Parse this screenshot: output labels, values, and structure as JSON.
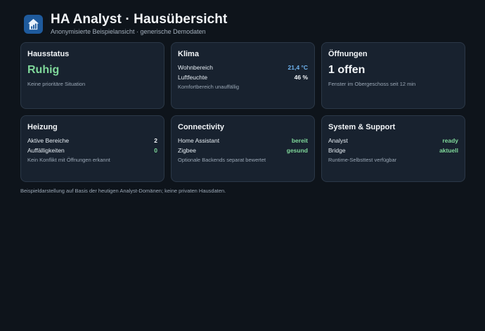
{
  "header": {
    "title": "HA Analyst · Hausübersicht",
    "subtitle": "Anonymisierte Beispielansicht · generische Demodaten",
    "logo_icon": "house-chart-icon"
  },
  "cards": {
    "hausstatus": {
      "title": "Hausstatus",
      "status": "Ruhig",
      "note": "Keine prioritäre Situation"
    },
    "klima": {
      "title": "Klima",
      "rows": [
        {
          "label": "Wohnbereich",
          "value": "21,4 °C"
        },
        {
          "label": "Luftfeuchte",
          "value": "46 %"
        }
      ],
      "note": "Komfortbereich unauffällig"
    },
    "oeffnungen": {
      "title": "Öffnungen",
      "status": "1 offen",
      "note": "Fenster im Obergeschoss seit 12 min"
    },
    "heizung": {
      "title": "Heizung",
      "rows": [
        {
          "label": "Aktive Bereiche",
          "value": "2"
        },
        {
          "label": "Auffälligkeiten",
          "value": "0"
        }
      ],
      "note": "Kein Konflikt mit Öffnungen erkannt"
    },
    "connectivity": {
      "title": "Connectivity",
      "rows": [
        {
          "label": "Home Assistant",
          "value": "bereit"
        },
        {
          "label": "Zigbee",
          "value": "gesund"
        }
      ],
      "note": "Optionale Backends separat bewertet"
    },
    "system": {
      "title": "System & Support",
      "rows": [
        {
          "label": "Analyst",
          "value": "ready"
        },
        {
          "label": "Bridge",
          "value": "aktuell"
        }
      ],
      "note": "Runtime-Selbsttest verfügbar"
    }
  },
  "footer": {
    "text": "Beispieldarstellung auf Basis der heutigen Analyst-Domänen; keine privaten Hausdaten."
  },
  "colors": {
    "background": "#0e141b",
    "card": "#18222f",
    "accent_green": "#7fd89a",
    "accent_blue": "#6fb3ee",
    "logo": "#1e5a9c"
  }
}
